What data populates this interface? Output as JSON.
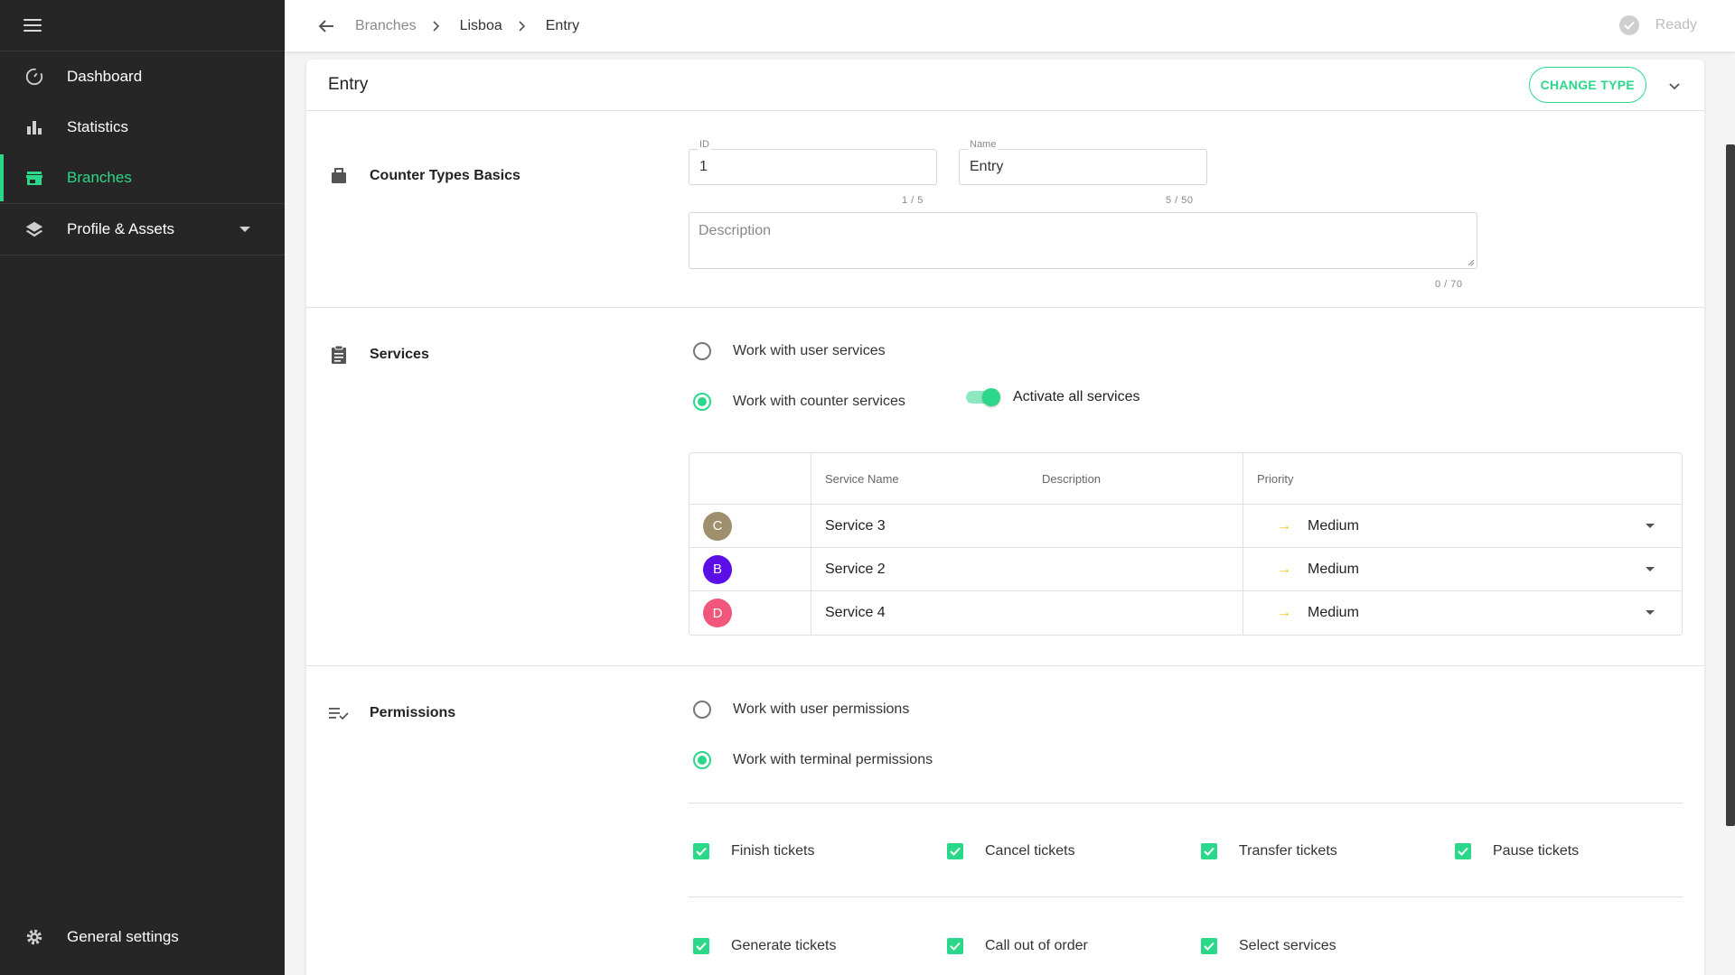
{
  "colors": {
    "accent": "#2bd88a",
    "sidebar_bg": "#262626",
    "priority_arrow": "#f5c400"
  },
  "sidebar": {
    "items": [
      {
        "label": "Dashboard",
        "icon": "speedometer-icon"
      },
      {
        "label": "Statistics",
        "icon": "bar-chart-icon"
      },
      {
        "label": "Branches",
        "icon": "store-icon",
        "active": true
      },
      {
        "label": "Profile & Assets",
        "icon": "layers-icon"
      }
    ],
    "footer": {
      "label": "General settings",
      "icon": "gear-icon"
    }
  },
  "header": {
    "breadcrumb": [
      "Branches",
      "Lisboa",
      "Entry"
    ],
    "status": "Ready"
  },
  "card": {
    "title": "Entry",
    "change_type_label": "CHANGE TYPE"
  },
  "basics": {
    "title": "Counter Types Basics",
    "id_label": "ID",
    "id_value": "1",
    "id_counter": "1 / 5",
    "name_label": "Name",
    "name_value": "Entry",
    "name_counter": "5 / 50",
    "description_placeholder": "Description",
    "description_counter": "0 / 70"
  },
  "services": {
    "title": "Services",
    "option_user": "Work with user services",
    "option_counter": "Work with counter services",
    "selected": "counter",
    "activate_all_label": "Activate all services",
    "activate_all_on": true,
    "table": {
      "headers": [
        "Service Name",
        "Description",
        "Priority"
      ],
      "rows": [
        {
          "avatar": "C",
          "avatar_color": "#a08f6c",
          "name": "Service 3",
          "description": "",
          "priority": "Medium"
        },
        {
          "avatar": "B",
          "avatar_color": "#5b0fe6",
          "name": "Service 2",
          "description": "",
          "priority": "Medium"
        },
        {
          "avatar": "D",
          "avatar_color": "#f0577a",
          "name": "Service 4",
          "description": "",
          "priority": "Medium"
        }
      ]
    }
  },
  "permissions": {
    "title": "Permissions",
    "option_user": "Work with user permissions",
    "option_terminal": "Work with terminal permissions",
    "selected": "terminal",
    "row1": [
      "Finish tickets",
      "Cancel tickets",
      "Transfer tickets",
      "Pause tickets"
    ],
    "row2": [
      "Generate tickets",
      "Call out of order",
      "Select services"
    ]
  }
}
